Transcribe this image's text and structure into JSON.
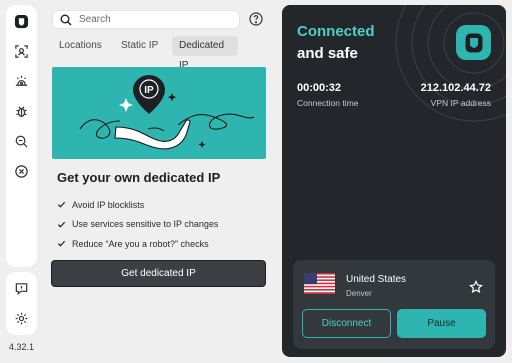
{
  "app": {
    "version": "4.32.1"
  },
  "sidebar": {
    "icons": [
      "app-logo-icon",
      "locations-icon",
      "tracker-blocker-icon",
      "malware-icon",
      "search-zoom-icon",
      "close-circle-icon"
    ],
    "bottom_icons": [
      "chat-icon",
      "settings-icon"
    ]
  },
  "search": {
    "placeholder": "Search"
  },
  "tabs": [
    {
      "label": "Locations"
    },
    {
      "label": "Static IP"
    },
    {
      "label": "Dedicated IP",
      "active": true
    }
  ],
  "promo": {
    "title": "Get your own dedicated IP",
    "bullets": [
      "Avoid IP blocklists",
      "Use services sensitive to IP changes",
      "Reduce “Are you a robot?” checks"
    ],
    "button_label": "Get dedicated IP",
    "banner_pin_text": "IP"
  },
  "status": {
    "title": "Connected",
    "subtitle": "and safe",
    "connection_time": "00:00:32",
    "connection_time_label": "Connection time",
    "ip": "212.102.44.72",
    "ip_label": "VPN IP address"
  },
  "location": {
    "country": "United States",
    "city": "Denver",
    "disconnect_label": "Disconnect",
    "pause_label": "Pause"
  },
  "colors": {
    "accent": "#2fb5b0",
    "accent_text": "#4ed0c5",
    "panel_dark": "#23272b",
    "card_dark": "#33383d"
  }
}
